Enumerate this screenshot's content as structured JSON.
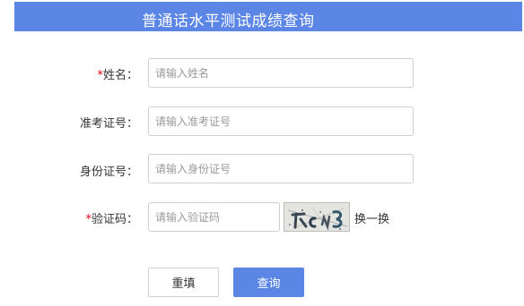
{
  "header": {
    "title": "普通话水平测试成绩查询"
  },
  "form": {
    "required_mark": "*",
    "name": {
      "label": "姓名：",
      "placeholder": "请输入姓名",
      "value": ""
    },
    "exam_no": {
      "label": "准考证号：",
      "placeholder": "请输入准考证号",
      "value": ""
    },
    "id_no": {
      "label": "身份证号：",
      "placeholder": "请输入身份证号",
      "value": ""
    },
    "captcha": {
      "label": "验证码：",
      "placeholder": "请输入验证码",
      "value": "",
      "refresh_label": "换一换"
    }
  },
  "buttons": {
    "reset_label": "重填",
    "query_label": "查询"
  },
  "colors": {
    "accent": "#5b86e5",
    "required": "#e60012"
  }
}
